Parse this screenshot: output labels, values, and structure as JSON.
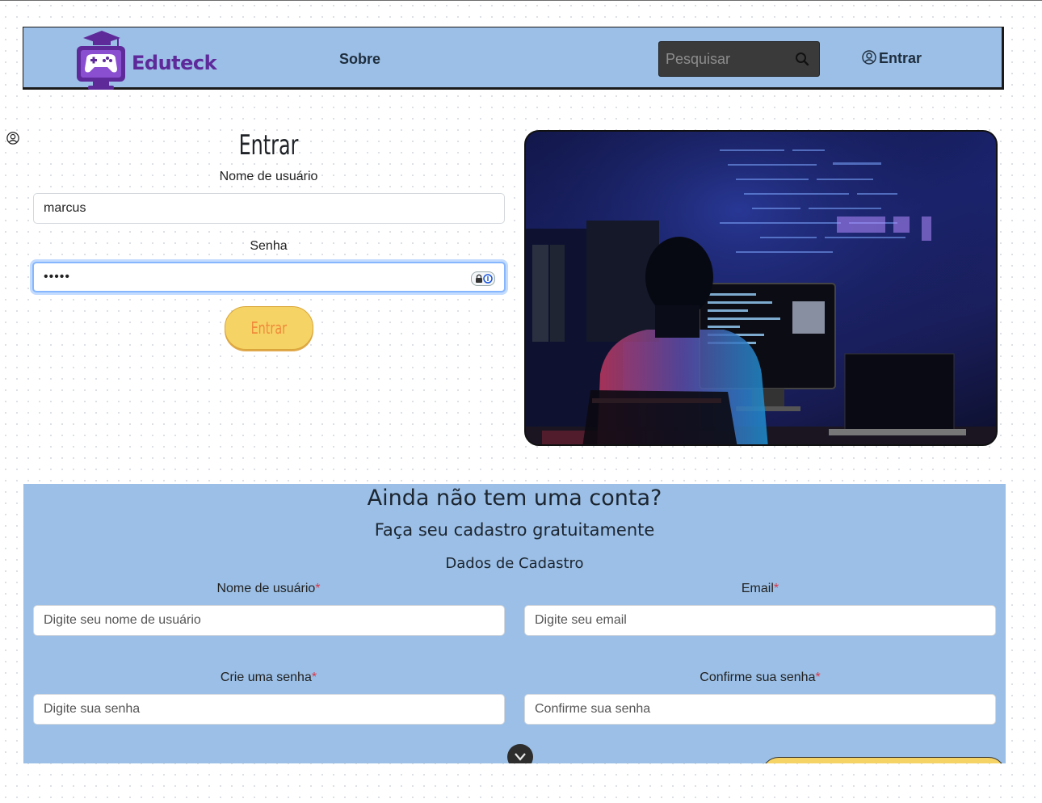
{
  "header": {
    "brand": "Eduteck",
    "nav_sobre": "Sobre",
    "search_placeholder": "Pesquisar",
    "nav_entrar": "Entrar"
  },
  "login": {
    "title": "Entrar",
    "username_label": "Nome de usuário",
    "username_value": "marcus",
    "password_label": "Senha",
    "password_value": "•••••",
    "submit_label": "Entrar"
  },
  "signup": {
    "heading": "Ainda não tem uma conta?",
    "subheading": "Faça seu cadastro gratuitamente",
    "section_title": "Dados de Cadastro",
    "required_mark": "*",
    "fields": [
      {
        "label": "Nome de usuário",
        "placeholder": "Digite seu nome de usuário"
      },
      {
        "label": "Email",
        "placeholder": "Digite seu email"
      },
      {
        "label": "Crie uma senha",
        "placeholder": "Digite sua senha"
      },
      {
        "label": "Confirme sua senha",
        "placeholder": "Confirme sua senha"
      }
    ]
  },
  "colors": {
    "header_bg": "#9bbfe6",
    "brand_purple": "#5e2a9a",
    "button_yellow": "#f6d365",
    "required_red": "#dc3545"
  },
  "icons": [
    "gamepad-logo-icon",
    "search-icon",
    "user-circle-icon",
    "lock-icon",
    "chevron-down-icon"
  ]
}
